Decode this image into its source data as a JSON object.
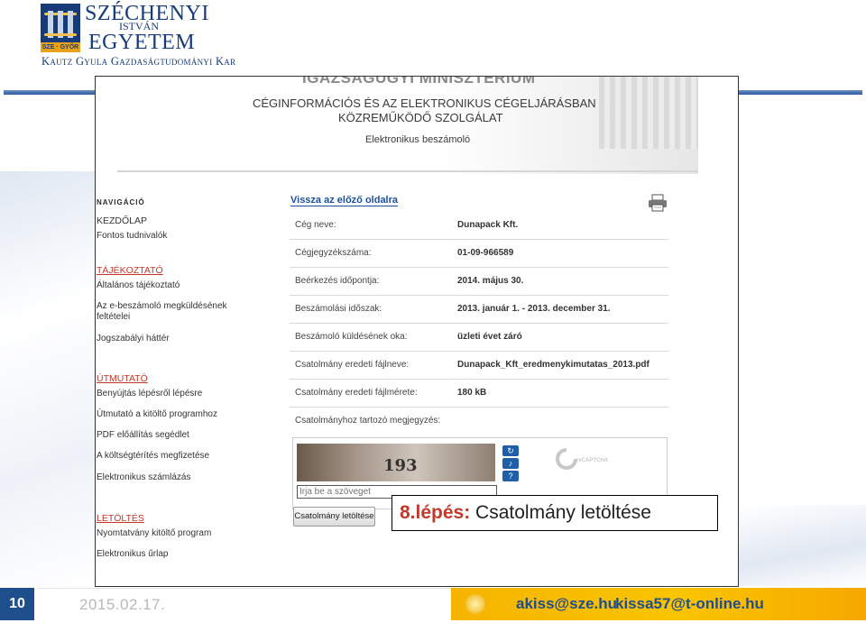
{
  "header": {
    "university_line1": "SZÉCHENYI",
    "university_line2": "ISTVÁN",
    "university_line3": "EGYETEM",
    "faculty": "Kautz Gyula Gazdaságtudományi Kar",
    "logo_caption": "SZE · GYŐR"
  },
  "banner": {
    "ministry": "IGAZSÁGÜGYI MINISZTÉRIUM",
    "service_line1": "CÉGINFORMÁCIÓS ÉS AZ ELEKTRONIKUS CÉGELJÁRÁSBAN",
    "service_line2": "KÖZREMŰKÖDŐ SZOLGÁLAT",
    "subtitle": "Elektronikus beszámoló"
  },
  "nav": {
    "title": "NAVIGÁCIÓ",
    "items": {
      "home": "KEZDŐLAP",
      "important_info": "Fontos tudnivalók",
      "info_head": "TÁJÉKOZTATÓ",
      "general_info": "Általános tájékoztató",
      "ebeszamolo_1": "Az e-beszámoló megküldésének",
      "ebeszamolo_2": "feltételei",
      "legal": "Jogszabályi háttér",
      "guide_head": "ÚTMUTATÓ",
      "submit_steps": "Benyújtás lépésről lépésre",
      "form_guide": "Útmutató a kitöltő programhoz",
      "pdf_helper": "PDF előállítás segédlet",
      "fee_payment": "A költségtérítés megfizetése",
      "einvoice": "Elektronikus számlázás",
      "download_head": "LETÖLTÉS",
      "printed_form": "Nyomtatvány kitöltő program",
      "eform": "Elektronikus űrlap"
    }
  },
  "content": {
    "back_link": "Vissza az előző oldalra",
    "rows": [
      {
        "label": "Cég neve:",
        "value": "Dunapack Kft."
      },
      {
        "label": "Cégjegyzékszáma:",
        "value": "01-09-966589"
      },
      {
        "label": "Beérkezés időpontja:",
        "value": "2014. május 30."
      },
      {
        "label": "Beszámolási időszak:",
        "value": "2013. január 1. - 2013. december 31."
      },
      {
        "label": "Beszámoló küldésének oka:",
        "value": "üzleti évet záró"
      },
      {
        "label": "Csatolmány eredeti fájlneve:",
        "value": "Dunapack_Kft_eredmenykimutatas_2013.pdf"
      },
      {
        "label": "Csatolmány eredeti fájlmérete:",
        "value": "180 kB"
      },
      {
        "label": "Csatolmányhoz tartozó megjegyzés:",
        "value": ""
      }
    ],
    "captcha": {
      "number": "193",
      "input_placeholder": "Írja be a szöveget",
      "logo_text": "reCAPTCHA"
    },
    "download_button": "Csatolmány letöltése"
  },
  "callout": {
    "label": "8.lépés:",
    "text": " Csatolmány letöltése"
  },
  "footer": {
    "page_number": "10",
    "date": "2015.02.17.",
    "email1": "akiss@sze.hu",
    "email2": "kissa57@t-online.hu"
  },
  "colors": {
    "brand_blue": "#173b78",
    "link_blue": "#1d4f9b",
    "nav_red": "#c0392b",
    "footer_yellow": "#f9c400"
  },
  "icons": [
    "printer-icon",
    "refresh-icon",
    "audio-icon",
    "help-icon",
    "recaptcha-logo-icon",
    "sun-icon"
  ]
}
